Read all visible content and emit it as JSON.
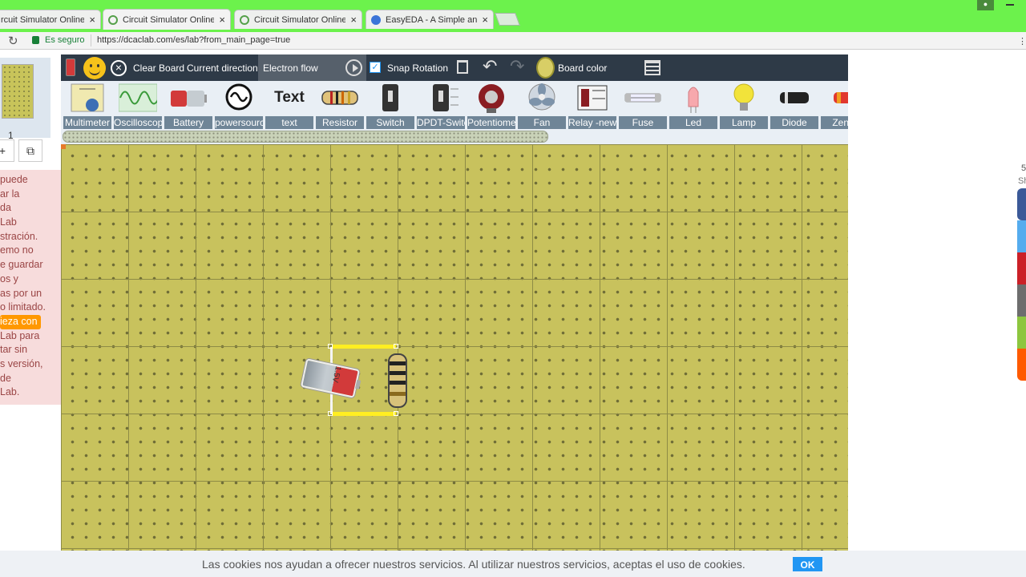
{
  "browser": {
    "tabs": [
      {
        "title": "rcuit Simulator Online -",
        "close": "×"
      },
      {
        "title": "Circuit Simulator Online -",
        "close": "×"
      },
      {
        "title": "Circuit Simulator Online -",
        "close": "×"
      },
      {
        "title": "EasyEDA - A Simple and",
        "close": "×"
      }
    ],
    "reload": "↻",
    "secure_label": "Es seguro",
    "url": "https://dcaclab.com/es/lab?from_main_page=true",
    "menu": "⋮"
  },
  "left_panel": {
    "thumbnail_number": "1",
    "btn_add": "+",
    "btn_copy": "⧉",
    "note_lines": [
      "puede",
      "ar la",
      "da",
      "Lab",
      "stración.",
      "emo no",
      "e guardar",
      "os y",
      "as por un",
      "o limitado."
    ],
    "cta": "ieza con",
    "note_lines_2": [
      "Lab para",
      "tar sin",
      "s versión,",
      "de",
      "Lab."
    ]
  },
  "toolbar": {
    "clear_board": "Clear Board",
    "current_direction_label": "Current direction:",
    "current_direction_value": "Electron flow",
    "snap_rotation": "Snap Rotation",
    "board_color": "Board color",
    "snap_checked": "✓",
    "undo": "↶",
    "redo": "↷",
    "clear_x": "×"
  },
  "palette": [
    {
      "label": "Multimeter",
      "icon": "multimeter-icon"
    },
    {
      "label": "Oscilloscope",
      "icon": "oscilloscope-icon"
    },
    {
      "label": "Battery",
      "icon": "battery-icon"
    },
    {
      "label": "powersource",
      "icon": "powersource-icon"
    },
    {
      "label": "text",
      "icon": "text-icon",
      "glyph": "Text"
    },
    {
      "label": "Resistor",
      "icon": "resistor-icon"
    },
    {
      "label": "Switch",
      "icon": "switch-icon"
    },
    {
      "label": "DPDT-Switch",
      "icon": "dpdt-switch-icon"
    },
    {
      "label": "Potentiometer",
      "icon": "potentiometer-icon"
    },
    {
      "label": "Fan",
      "icon": "fan-icon"
    },
    {
      "label": "Relay -new",
      "icon": "relay-icon"
    },
    {
      "label": "Fuse",
      "icon": "fuse-icon"
    },
    {
      "label": "Led",
      "icon": "led-icon"
    },
    {
      "label": "Lamp",
      "icon": "lamp-icon"
    },
    {
      "label": "Diode",
      "icon": "diode-icon"
    },
    {
      "label": "Zener",
      "icon": "zener-icon"
    }
  ],
  "circuit": {
    "battery_voltage": "1.5V"
  },
  "share": {
    "count": "5",
    "label": "Sh"
  },
  "colors": {
    "board": "#c8c25d",
    "wire": "#ffee22",
    "toolbar": "#2e3a47",
    "tabstrip": "#6cf24c",
    "cookie_ok": "#2196f3",
    "share_facebook": "#3b5998",
    "share_twitter": "#55acee",
    "share_pinterest": "#cb2027",
    "share_print": "#6d6d6d",
    "share_green": "#8dc63f",
    "share_orange": "#ff5a00"
  },
  "cookies": {
    "text": "Las cookies nos ayudan a ofrecer nuestros servicios. Al utilizar nuestros servicios, aceptas el uso de cookies.",
    "ok": "OK"
  }
}
